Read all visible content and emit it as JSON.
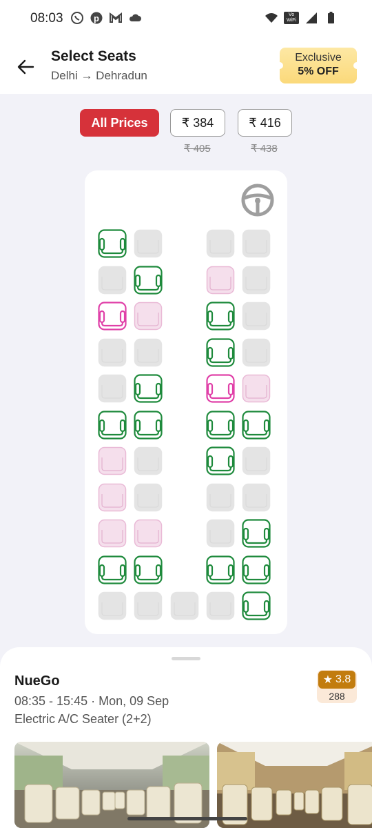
{
  "status_bar": {
    "time": "08:03",
    "vowifi": "Vo WiFi"
  },
  "header": {
    "title": "Select Seats",
    "route": "Delhi → Dehradun",
    "offer_line1": "Exclusive",
    "offer_line2": "5% OFF"
  },
  "price_filters": [
    {
      "label": "All Prices",
      "original": ""
    },
    {
      "label": "₹ 384",
      "original": "₹ 405"
    },
    {
      "label": "₹ 416",
      "original": "₹ 438"
    }
  ],
  "seat_legend_colors": {
    "available": "#1e8a3c",
    "ladies": "#e040a8",
    "booked": "#e4e4e4",
    "booked_ladies": "#f5dfec"
  },
  "seat_map": {
    "rows": [
      [
        "available",
        "booked",
        "",
        "booked",
        "booked"
      ],
      [
        "booked",
        "available",
        "",
        "booked_ladies",
        "booked"
      ],
      [
        "ladies",
        "booked_ladies",
        "",
        "available",
        "booked"
      ],
      [
        "booked",
        "booked",
        "",
        "available",
        "booked"
      ],
      [
        "booked",
        "available",
        "",
        "ladies",
        "booked_ladies"
      ],
      [
        "available",
        "available",
        "",
        "available",
        "available"
      ],
      [
        "booked_ladies",
        "booked",
        "",
        "available",
        "booked"
      ],
      [
        "booked_ladies",
        "booked",
        "",
        "booked",
        "booked"
      ],
      [
        "booked_ladies",
        "booked_ladies",
        "",
        "booked",
        "available"
      ],
      [
        "available",
        "available",
        "",
        "available",
        "available"
      ],
      [
        "booked",
        "booked",
        "booked",
        "booked",
        "available"
      ]
    ]
  },
  "bus": {
    "operator": "NueGo",
    "timing": "08:35 - 15:45 · Mon, 09 Sep",
    "type": "Electric A/C Seater (2+2)",
    "rating": "3.8",
    "rating_count": "288"
  }
}
